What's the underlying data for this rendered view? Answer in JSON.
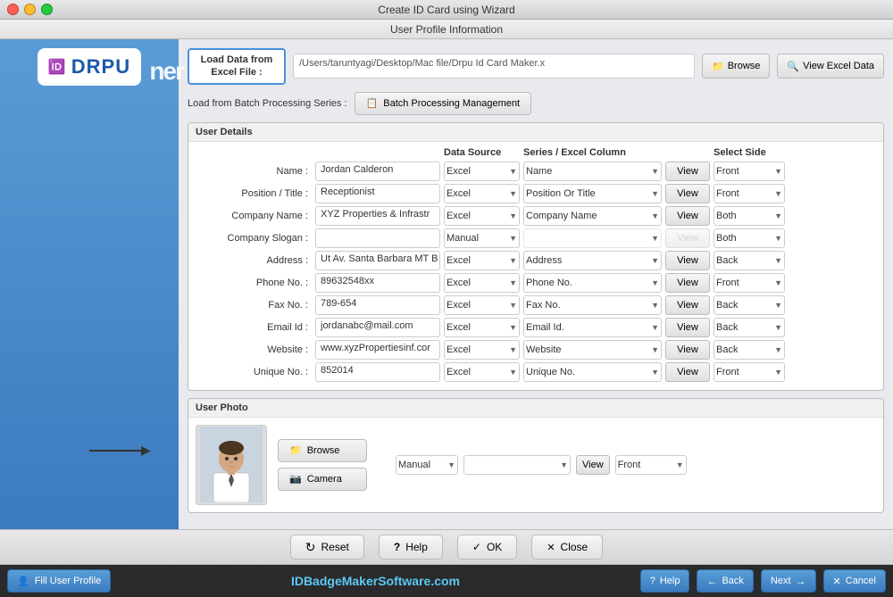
{
  "window": {
    "title": "Create ID Card using Wizard",
    "subtitle": "User Profile Information",
    "traffic_light": [
      "red",
      "yellow",
      "green"
    ]
  },
  "sidebar": {
    "logo": "DRPU",
    "right_text": "ner"
  },
  "file_load": {
    "label_line1": "Load Data from",
    "label_line2": "Excel File :",
    "file_path": "/Users/taruntyagi/Desktop/Mac file/Drpu Id Card Maker.x",
    "browse_label": "Browse",
    "view_excel_label": "View Excel Data"
  },
  "batch": {
    "label": "Load from Batch Processing Series :",
    "button_label": "Batch Processing Management"
  },
  "user_details": {
    "section_title": "User Details",
    "col_headers": {
      "data_source": "Data Source",
      "series_excel": "Series / Excel Column",
      "select_side": "Select Side"
    },
    "rows": [
      {
        "label": "Name :",
        "value": "Jordan Calderon",
        "source": "Excel",
        "series": "Name",
        "view_enabled": true,
        "side": "Front"
      },
      {
        "label": "Position / Title :",
        "value": "Receptionist",
        "source": "Excel",
        "series": "Position Or Title",
        "view_enabled": true,
        "side": "Front"
      },
      {
        "label": "Company Name :",
        "value": "XYZ Properties & Infrastr",
        "source": "Excel",
        "series": "Company Name",
        "view_enabled": true,
        "side": "Both"
      },
      {
        "label": "Company Slogan :",
        "value": "",
        "source": "Manual",
        "series": "",
        "view_enabled": false,
        "side": "Both"
      },
      {
        "label": "Address :",
        "value": "Ut Av. Santa Barbara MT B",
        "source": "Excel",
        "series": "Address",
        "view_enabled": true,
        "side": "Back"
      },
      {
        "label": "Phone No. :",
        "value": "89632548xx",
        "source": "Excel",
        "series": "Phone No.",
        "view_enabled": true,
        "side": "Front"
      },
      {
        "label": "Fax No. :",
        "value": "789-654",
        "source": "Excel",
        "series": "Fax No.",
        "view_enabled": true,
        "side": "Back"
      },
      {
        "label": "Email Id :",
        "value": "jordanabc@mail.com",
        "source": "Excel",
        "series": "Email Id.",
        "view_enabled": true,
        "side": "Back"
      },
      {
        "label": "Website :",
        "value": "www.xyzPropertiesinf.cor",
        "source": "Excel",
        "series": "Website",
        "view_enabled": true,
        "side": "Back"
      },
      {
        "label": "Unique No. :",
        "value": "852014",
        "source": "Excel",
        "series": "Unique No.",
        "view_enabled": true,
        "side": "Front"
      }
    ],
    "source_options": [
      "Excel",
      "Manual"
    ],
    "side_options": [
      "Front",
      "Back",
      "Both"
    ]
  },
  "user_photo": {
    "section_title": "User Photo",
    "browse_label": "Browse",
    "camera_label": "Camera",
    "source": "Manual",
    "series": "",
    "view_label": "View",
    "side": "Front"
  },
  "bottom_actions": {
    "reset_label": "Reset",
    "help_label": "Help",
    "ok_label": "OK",
    "close_label": "Close"
  },
  "footer": {
    "fill_profile_label": "Fill User Profile",
    "brand_text": "IDBadgeMakerSoftware",
    "brand_tld": ".com",
    "help_label": "Help",
    "back_label": "Back",
    "next_label": "Next",
    "cancel_label": "Cancel"
  }
}
